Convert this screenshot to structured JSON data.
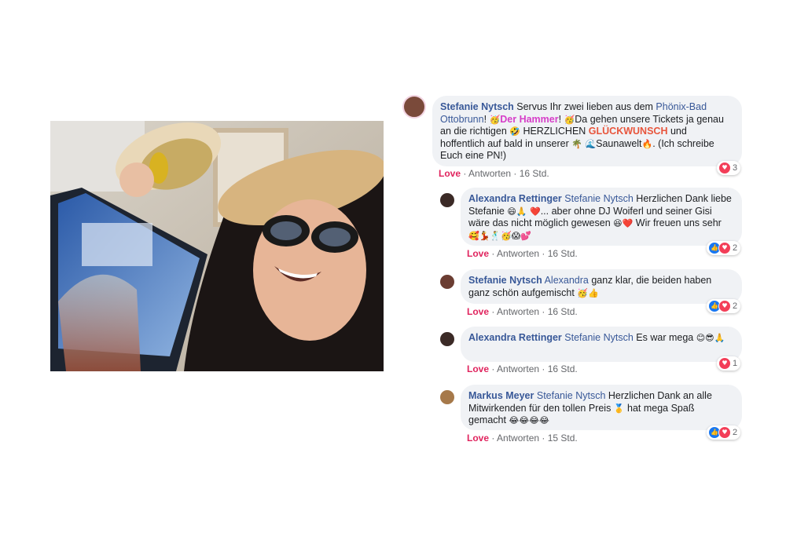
{
  "photo": {
    "subject": "selfie-photo"
  },
  "comments": [
    {
      "author": "Stefanie Nytsch",
      "parts": {
        "p1": " Servus Ihr zwei lieben aus dem ",
        "mention": "Phönix-Bad Ottobrunn",
        "p2": "! ",
        "e1": "🥳",
        "hl1": "Der Hammer",
        "p3": "! ",
        "e2": "🥳",
        "p4": "Da gehen unsere Tickets ja genau an die richtigen ",
        "e3": "🤣",
        "p5": " HERZLICHEN ",
        "hl2": "GLÜCKWUNSCH",
        "p6": " und hoffentlich auf bald in unserer ",
        "e4": "🌴 🌊",
        "p7": "Saunawelt",
        "e5": "🔥",
        "p8": ". (Ich schreibe Euch eine PN!)"
      },
      "love": "Love",
      "reply": "Antworten",
      "time": "16 Std.",
      "reaction_count": "3"
    },
    {
      "author": "Alexandra Rettinger",
      "mention": "Stefanie Nytsch",
      "text1": " Herzlichen Dank liebe Stefanie ",
      "e1": "😄🙏 ❤️",
      "text2": "... aber ohne DJ Woiferl und seiner Gisi wäre das nicht möglich gewesen ",
      "e2": "😆❤️",
      "text3": " Wir freuen uns sehr ",
      "e3": "🥰💃🕺🥳😱💕",
      "love": "Love",
      "reply": "Antworten",
      "time": "16 Std.",
      "reaction_count": "2"
    },
    {
      "author": "Stefanie Nytsch",
      "mention": "Alexandra",
      "text1": " ganz klar, die beiden haben ganz schön aufgemischt ",
      "e1": "🥳👍",
      "love": "Love",
      "reply": "Antworten",
      "time": "16 Std.",
      "reaction_count": "2"
    },
    {
      "author": "Alexandra Rettinger",
      "mention": "Stefanie Nytsch",
      "text1": " Es war mega ",
      "e1": "😊😎🙏",
      "love": "Love",
      "reply": "Antworten",
      "time": "16 Std.",
      "reaction_count": "1"
    },
    {
      "author": "Markus Meyer",
      "mention": "Stefanie Nytsch",
      "text1": " Herzlichen Dank an alle Mitwirkenden für den tollen Preis ",
      "e1": "🥇",
      "text2": " hat mega Spaß gemacht ",
      "e2": "😂😂😂😂",
      "love": "Love",
      "reply": "Antworten",
      "time": "15 Std.",
      "reaction_count": "2"
    }
  ],
  "separator": " · ",
  "colors": {
    "author": "#385898",
    "love": "#e0245e",
    "bubble": "#f0f2f5",
    "like": "#1877f2",
    "heart": "#f33e58"
  }
}
